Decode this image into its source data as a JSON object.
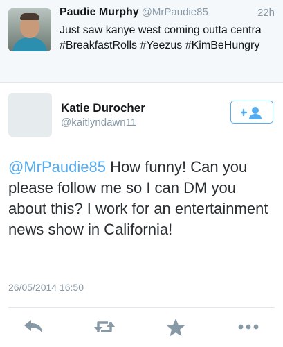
{
  "parent_tweet": {
    "author_name": "Paudie Murphy",
    "author_handle": "@MrPaudie85",
    "time_ago": "22h",
    "text": "Just saw kanye west coming outta centra #BreakfastRolls #Yeezus #KimBeHungry"
  },
  "main_tweet": {
    "author_name": "Katie Durocher",
    "author_handle": "@kaitlyndawn11",
    "mention": "@MrPaudie85",
    "text": " How funny! Can you please follow me so I can DM you about this? I work for an entertainment news show in California!",
    "timestamp": "26/05/2014 16:50"
  },
  "icons": {
    "follow": "follow-user-icon",
    "reply": "reply-icon",
    "retweet": "retweet-icon",
    "favorite": "star-icon",
    "more": "more-icon"
  },
  "colors": {
    "accent": "#55acee",
    "secondary_text": "#8899a6",
    "icon_gray": "#8899a6",
    "parent_background": "#f5f8fa"
  }
}
